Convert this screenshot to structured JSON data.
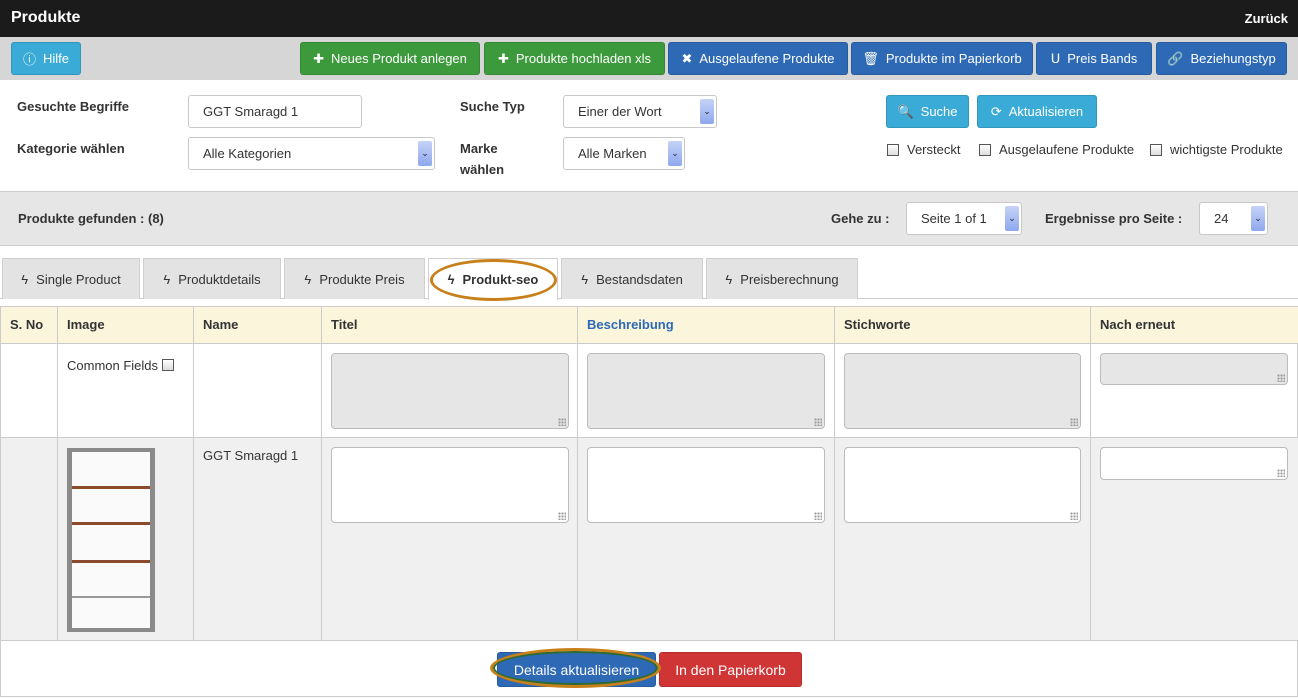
{
  "header": {
    "title": "Produkte",
    "back": "Zurück"
  },
  "toolbar": {
    "help": "Hilfe",
    "buttons": [
      "Neues Produkt anlegen",
      "Produkte hochladen xls",
      "Ausgelaufene Produkte",
      "Produkte im Papierkorb",
      "Preis Bands",
      "Beziehungstyp"
    ]
  },
  "search": {
    "terms_label": "Gesuchte Begriffe",
    "terms_value": "GGT Smaragd 1",
    "type_label": "Suche Typ",
    "type_value": "Einer der Wort",
    "category_label": "Kategorie wählen",
    "category_value": "Alle Kategorien",
    "brand_label_1": "Marke",
    "brand_label_2": "wählen",
    "brand_value": "Alle Marken",
    "search_btn": "Suche",
    "refresh_btn": "Aktualisieren",
    "checkboxes": [
      "Versteckt",
      "Ausgelaufene Produkte",
      "wichtigste Produkte"
    ]
  },
  "results": {
    "found": "Produkte gefunden : (8)",
    "goto_label": "Gehe zu :",
    "page_value": "Seite 1 of 1",
    "per_page_label": "Ergebnisse pro Seite :",
    "per_page_value": "24"
  },
  "tabs": [
    "Single Product",
    "Produktdetails",
    "Produkte Preis",
    "Produkt-seo",
    "Bestandsdaten",
    "Preisberechnung"
  ],
  "active_tab": "Produkt-seo",
  "table": {
    "headers": [
      "S. No",
      "Image",
      "Name",
      "Titel",
      "Beschreibung",
      "Stichworte",
      "Nach erneut"
    ],
    "common_fields": "Common Fields",
    "rows": [
      {
        "name": "GGT Smaragd 1"
      }
    ]
  },
  "footer": {
    "update": "Details aktualisieren",
    "trash": "In den Papierkorb"
  },
  "colors": {
    "green": "#3c9a3c",
    "blue": "#2d69b5",
    "cyan": "#3aabd6",
    "red": "#d03535",
    "highlight": "#c8801a"
  }
}
